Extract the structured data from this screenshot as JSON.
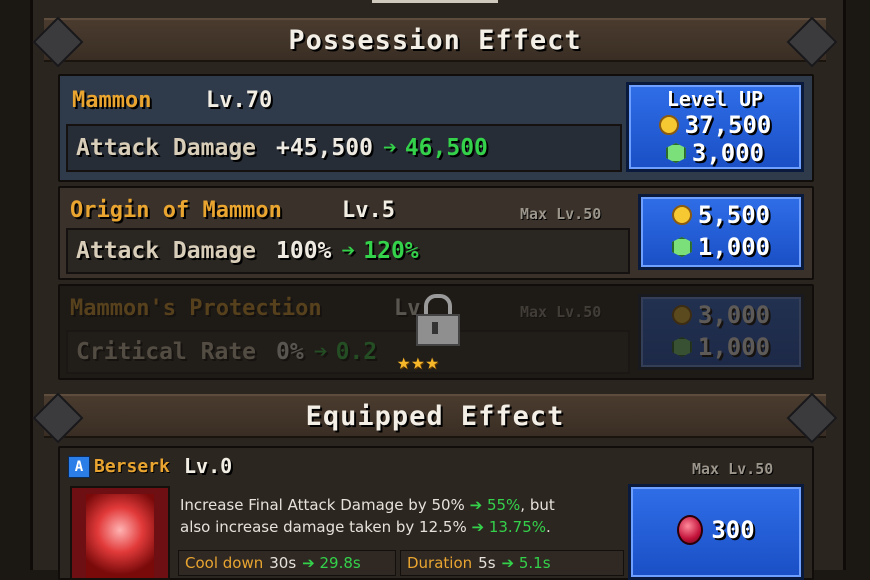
{
  "possession": {
    "title": "Possession Effect",
    "main": {
      "name": "Mammon",
      "level": "Lv.70",
      "stat_label": "Attack Damage",
      "stat_current": "+45,500",
      "stat_next": "46,500",
      "button": {
        "label": "Level UP",
        "gold": "37,500",
        "gem": "3,000"
      }
    },
    "origin": {
      "name": "Origin of Mammon",
      "level": "Lv.5",
      "max_level": "Max Lv.50",
      "stat_label": "Attack Damage",
      "stat_current": "100%",
      "stat_next": "120%",
      "button": {
        "gold": "5,500",
        "gem": "1,000"
      }
    },
    "protection": {
      "name": "Mammon's Protection",
      "level": "Lv",
      "max_level": "Max Lv.50",
      "stat_label": "Critical Rate",
      "stat_current": "0%",
      "stat_next": "0.2",
      "stars": "★★★",
      "button": {
        "gold": "3,000",
        "gem": "1,000"
      }
    }
  },
  "equipped": {
    "title": "Equipped Effect",
    "skill": {
      "badge": "A",
      "name": "Berserk",
      "level": "Lv.0",
      "max_level": "Max Lv.50",
      "desc1": "Increase Final Attack Damage by 50%",
      "desc1_new": "55%",
      "desc1_tail": ", but",
      "desc2": "also increase damage taken by 12.5%",
      "desc2_new": "13.75%",
      "desc2_tail": ".",
      "cooldown_label": "Cool down",
      "cooldown_value": "30s",
      "cooldown_new": "29.8s",
      "duration_label": "Duration",
      "duration_value": "5s",
      "duration_new": "5.1s",
      "cost": "300"
    }
  },
  "arrow": "➔"
}
